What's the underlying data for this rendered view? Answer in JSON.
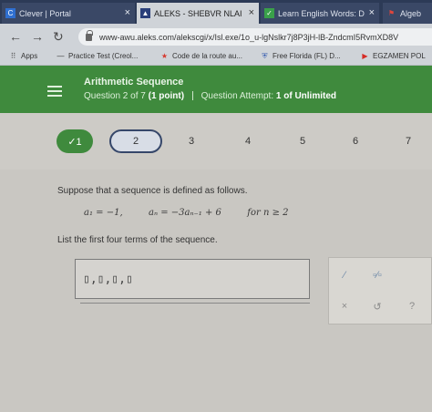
{
  "browser": {
    "tabs": [
      {
        "label": "Clever | Portal",
        "icon": "clever-icon",
        "active": false
      },
      {
        "label": "ALEKS - SHEBVR NLAI",
        "icon": "aleks-icon",
        "active": true
      },
      {
        "label": "Learn English Words: D",
        "icon": "learning-icon",
        "active": false
      },
      {
        "label": "Algeb",
        "icon": "flag-icon",
        "active": false
      }
    ],
    "tab_close": "×",
    "url": "www-awu.aleks.com/alekscgi/x/Isl.exe/1o_u-lgNslkr7j8P3jH-lB-ZndcmI5RvmXD8V",
    "bookmarks": [
      {
        "label": "Apps",
        "icon": "apps-grid-icon"
      },
      {
        "label": "Practice Test (Creol...",
        "icon": "dash-icon"
      },
      {
        "label": "Code de la route au...",
        "icon": "star-icon"
      },
      {
        "label": "Free Florida (FL) D...",
        "icon": "shield-icon"
      },
      {
        "label": "EGZAMEN POL",
        "icon": "youtube-icon"
      }
    ]
  },
  "header": {
    "topic": "Arithmetic Sequence",
    "question_label": "Question 2 of 7",
    "points": "(1 point)",
    "attempt_label": "Question Attempt:",
    "attempt_value": "1 of Unlimited"
  },
  "question_nav": {
    "items": [
      {
        "label": "✓1",
        "state": "done"
      },
      {
        "label": "2",
        "state": "current"
      },
      {
        "label": "3",
        "state": "pending"
      },
      {
        "label": "4",
        "state": "pending"
      },
      {
        "label": "5",
        "state": "pending"
      },
      {
        "label": "6",
        "state": "pending"
      },
      {
        "label": "7",
        "state": "pending"
      }
    ]
  },
  "problem": {
    "prompt": "Suppose that a sequence is defined as follows.",
    "formula_a1": "a₁ = −1,",
    "formula_an": "aₙ = −3aₙ₋₁ + 6",
    "formula_condition": "for   n ≥ 2",
    "instruction": "List the first four terms of the sequence.",
    "answer_value": "▯,▯,▯,▯"
  },
  "tools": {
    "fraction": "⁄",
    "mixed_number": "▫⁄▫",
    "clear": "×",
    "undo": "↺",
    "help": "?"
  },
  "colors": {
    "aleks_green": "#3f8a3d",
    "current_question_border": "#36476a",
    "tab_strip": "#2c3a56"
  }
}
